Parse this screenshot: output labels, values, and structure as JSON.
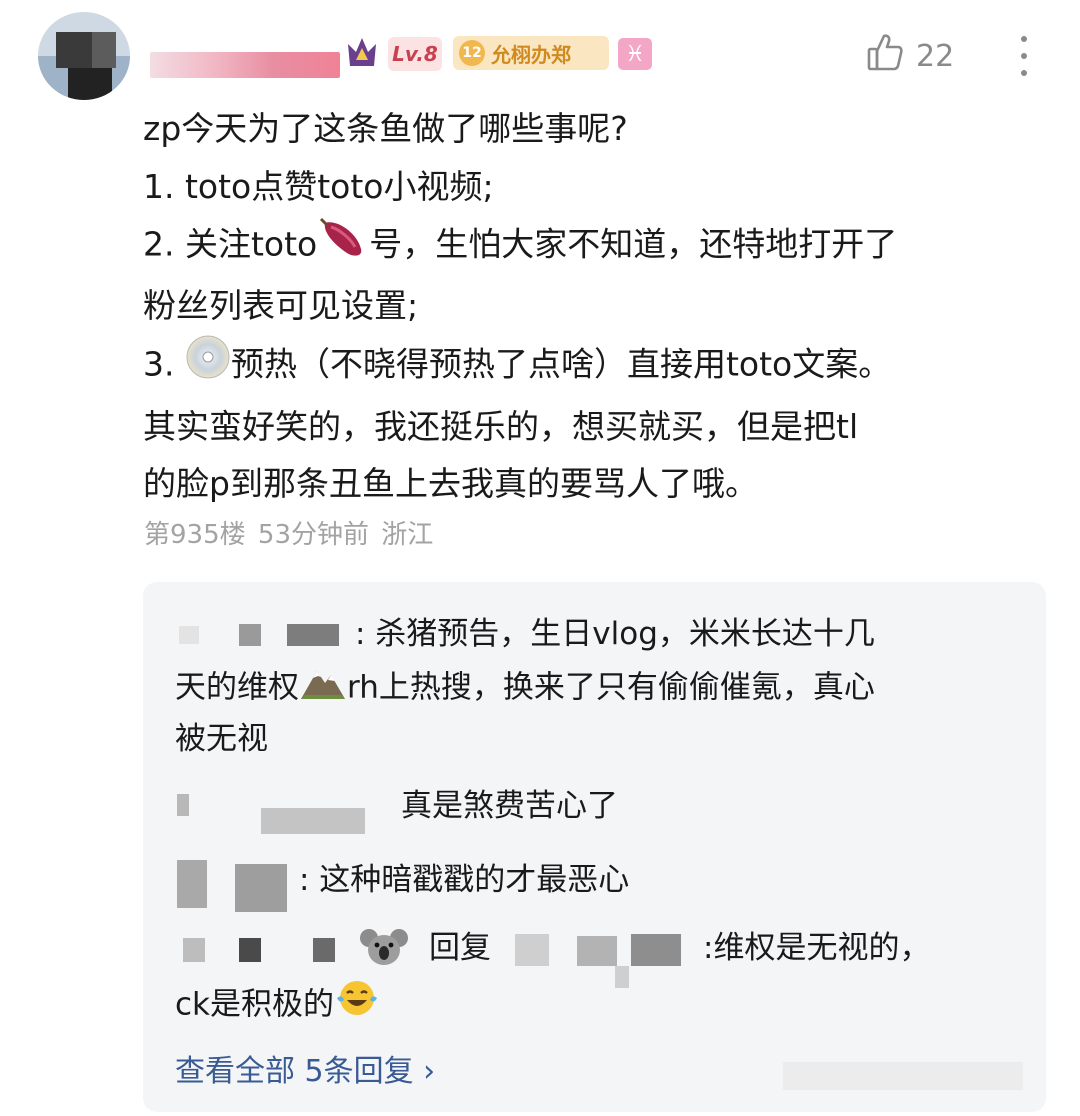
{
  "comment": {
    "level_badge": "Lv.8",
    "fan_badge_level": "12",
    "fan_badge_name": "允栩办郑",
    "zodiac_symbol": "♓",
    "like_count": "22",
    "lines": [
      "zp今天为了这条鱼做了哪些事呢?",
      "1. toto点赞toto小视频;",
      "2. 关注toto",
      "号，生怕大家不知道，还特地打开了",
      "粉丝列表可见设置;",
      "3. ",
      "预热（不晓得预热了点啥）直接用toto文案。",
      "其实蛮好笑的，我还挺乐的，想买就买，但是把tl",
      "的脸p到那条丑鱼上去我真的要骂人了哦。"
    ],
    "meta": {
      "floor": "第935楼",
      "time": "53分钟前",
      "location": "浙江"
    }
  },
  "replies": {
    "r1_a": ": 杀猪预告，生日vlog，米米长达十几",
    "r1_b": "天的维权",
    "r1_c": "rh上热搜，换来了只有偷偷催氪，真心",
    "r1_d": "被无视",
    "r2": "真是煞费苦心了",
    "r3": ": 这种暗戳戳的才最恶心",
    "r4_reply": "回复",
    "r4_a": ":维权是无视的，",
    "r4_b": "ck是积极的",
    "view_all": "查看全部 5条回复 ›"
  },
  "icons": {
    "crown": "crown-icon",
    "like": "thumbs-up-icon",
    "more": "more-vertical-icon",
    "sweet_potato": "sweet-potato-emoji",
    "disc": "dvd-disc-emoji",
    "mountain": "mountain-emoji",
    "koala": "koala-emoji",
    "laugh": "tears-of-joy-emoji"
  },
  "colors": {
    "level_badge_bg": "#fbe3e3",
    "level_badge_fg": "#c7414f",
    "fan_badge_bg": "#fbe6c2",
    "fan_badge_fg": "#d08a1f",
    "zodiac_bg": "#f4a6c6",
    "reply_box_bg": "#f4f5f7",
    "link": "#3a5a96",
    "meta_gray": "#a3a3a3"
  }
}
